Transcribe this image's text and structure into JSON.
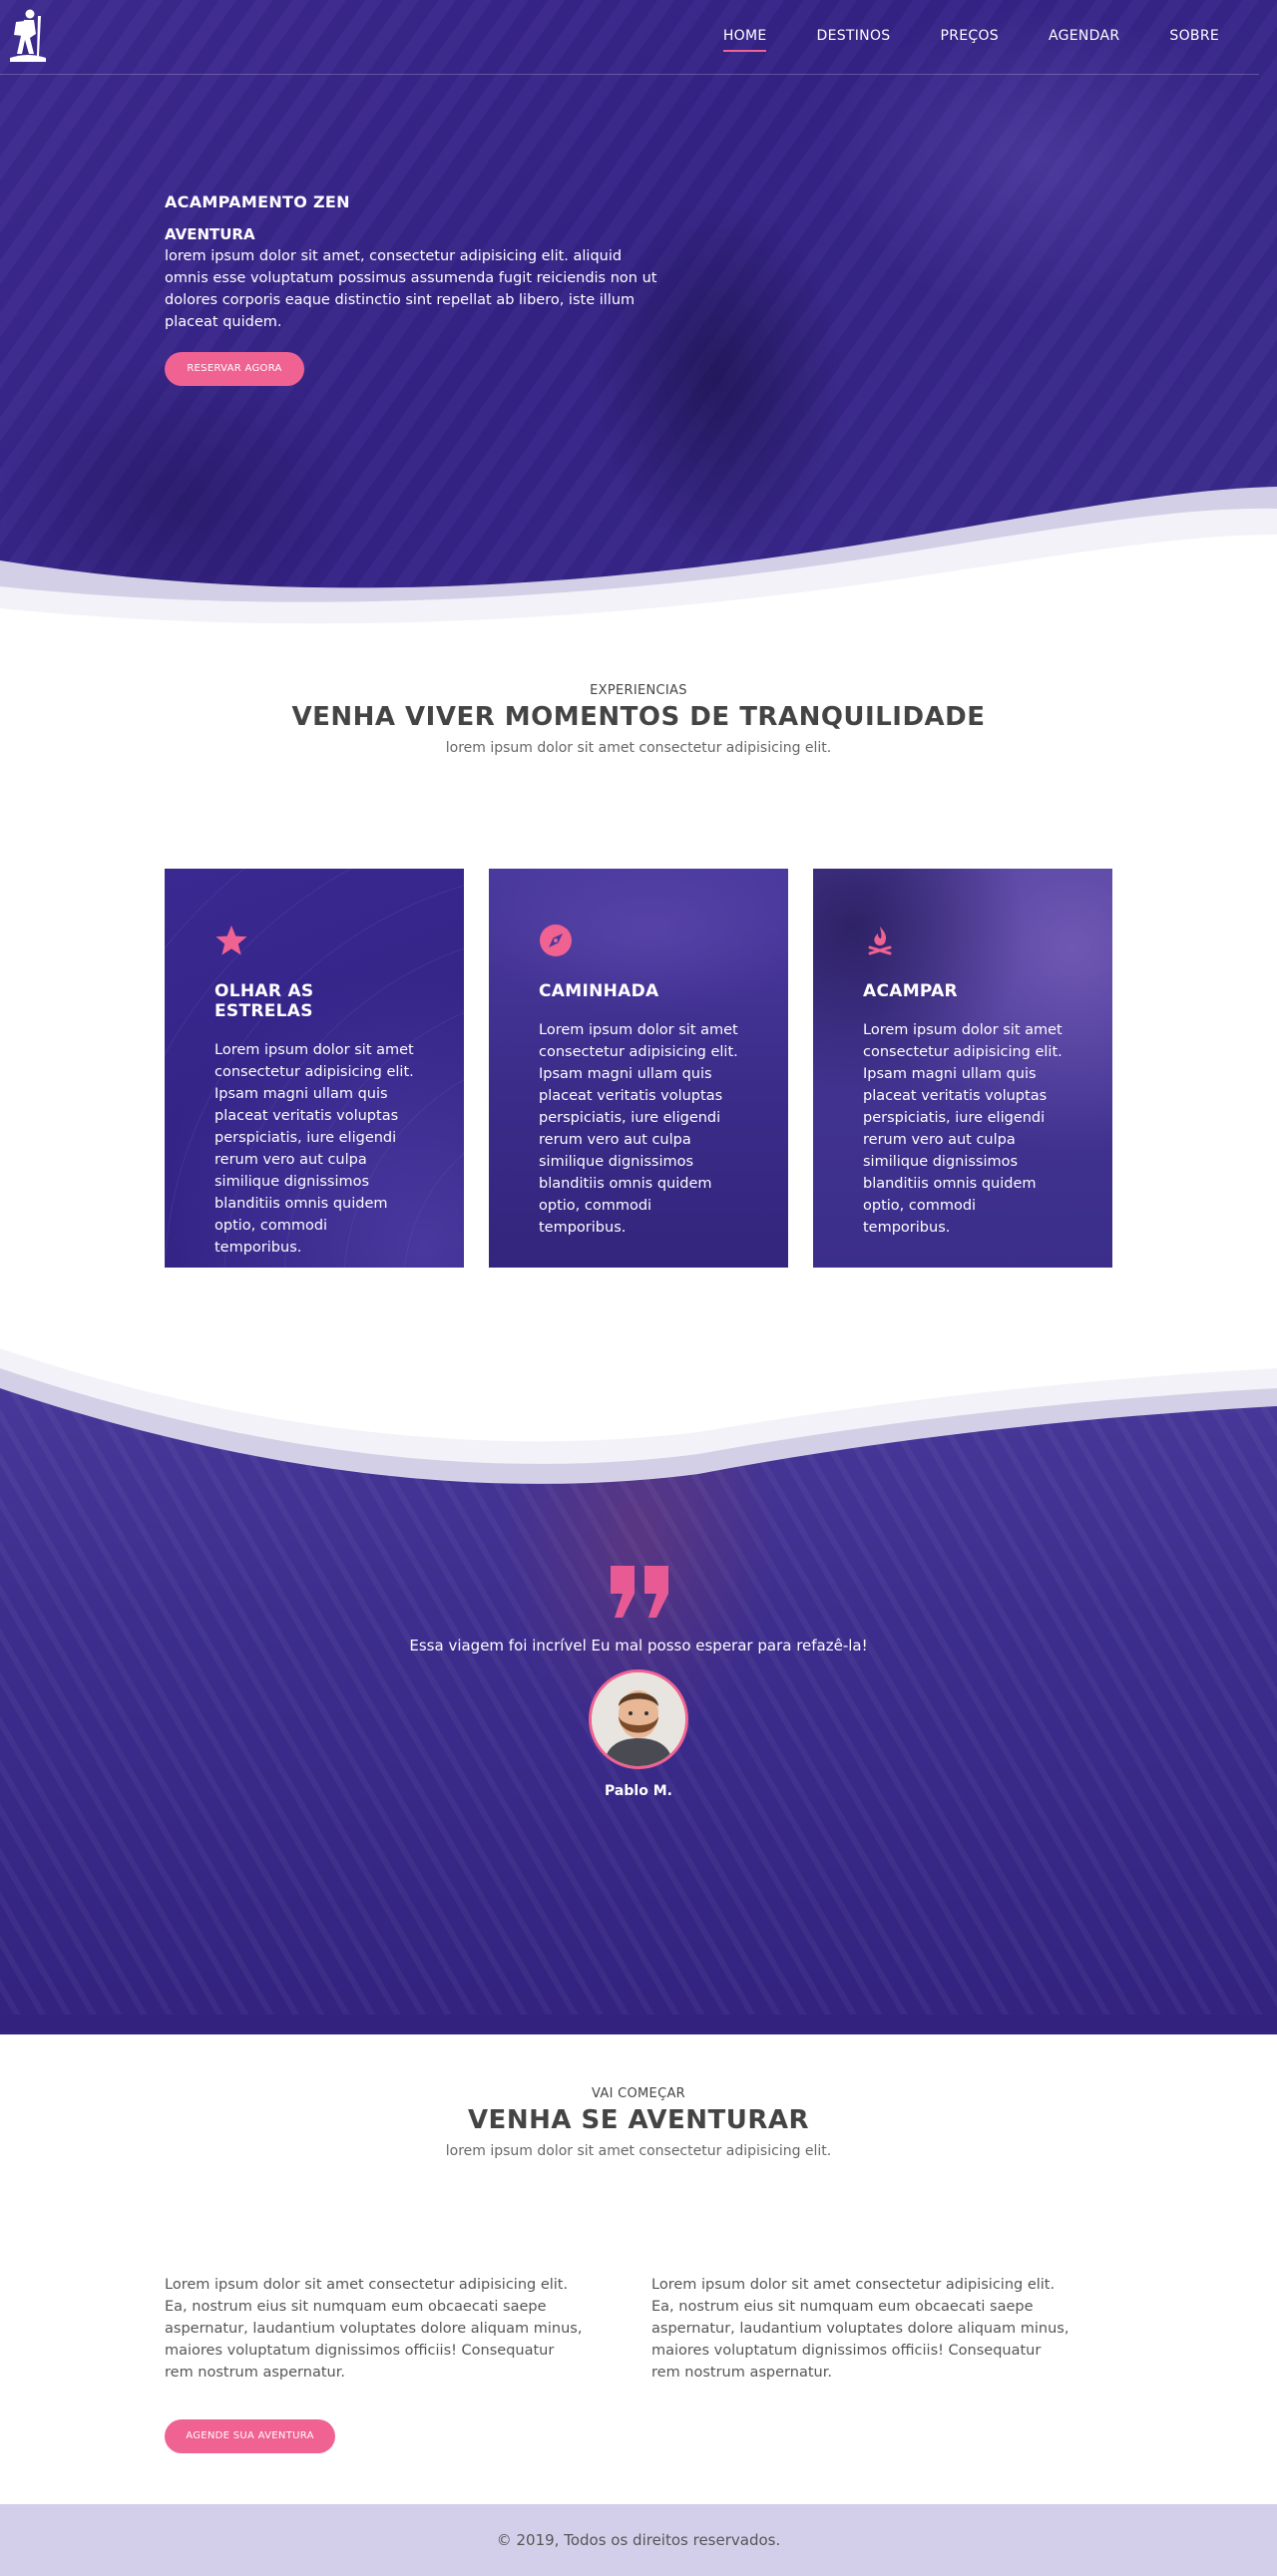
{
  "nav": {
    "logo_icon": "hiker-icon",
    "items": [
      {
        "label": "HOME",
        "active": true
      },
      {
        "label": "DESTINOS",
        "active": false
      },
      {
        "label": "PREÇOS",
        "active": false
      },
      {
        "label": "AGENDAR",
        "active": false
      },
      {
        "label": "SOBRE",
        "active": false
      }
    ]
  },
  "hero": {
    "title": "ACAMPAMENTO ZEN",
    "subtitle": "AVENTURA",
    "text": "lorem ipsum dolor sit amet, consectetur adipisicing elit. aliquid omnis esse voluptatum possimus assumenda fugit reiciendis non ut dolores corporis eaque distinctio sint repellat ab libero, iste illum placeat quidem.",
    "cta": "RESERVAR AGORA"
  },
  "experiences": {
    "kicker": "EXPERIENCIAS",
    "title": "VENHA VIVER MOMENTOS DE TRANQUILIDADE",
    "lead": "lorem ipsum dolor sit amet consectetur adipisicing elit.",
    "cards": [
      {
        "icon": "star-icon",
        "title": "OLHAR AS ESTRELAS",
        "text": "Lorem ipsum dolor sit amet consectetur adipisicing elit. Ipsam magni ullam quis placeat veritatis voluptas perspiciatis, iure eligendi rerum vero aut culpa similique dignissimos blanditiis omnis quidem optio, commodi temporibus."
      },
      {
        "icon": "compass-icon",
        "title": "CAMINHADA",
        "text": "Lorem ipsum dolor sit amet consectetur adipisicing elit. Ipsam magni ullam quis placeat veritatis voluptas perspiciatis, iure eligendi rerum vero aut culpa similique dignissimos blanditiis omnis quidem optio, commodi temporibus."
      },
      {
        "icon": "campfire-icon",
        "title": "ACAMPAR",
        "text": "Lorem ipsum dolor sit amet consectetur adipisicing elit. Ipsam magni ullam quis placeat veritatis voluptas perspiciatis, iure eligendi rerum vero aut culpa similique dignissimos blanditiis omnis quidem optio, commodi temporibus."
      }
    ]
  },
  "testimonial": {
    "quote": "Essa viagem foi incrível Eu mal posso esperar para refazê-la!",
    "author": "Pablo M."
  },
  "adventure": {
    "kicker": "VAI COMEÇAR",
    "title": "VENHA SE AVENTURAR",
    "lead": "lorem ipsum dolor sit amet consectetur adipisicing elit.",
    "col1": "Lorem ipsum dolor sit amet consectetur adipisicing elit. Ea, nostrum eius sit numquam eum obcaecati saepe aspernatur, laudantium voluptates dolore aliquam minus, maiores voluptatum dignissimos officiis! Consequatur rem nostrum aspernatur.",
    "col2": "Lorem ipsum dolor sit amet consectetur adipisicing elit. Ea, nostrum eius sit numquam eum obcaecati saepe aspernatur, laudantium voluptates dolore aliquam minus, maiores voluptatum dignissimos officiis! Consequatur rem nostrum aspernatur.",
    "cta": "AGENDE SUA AVENTURA"
  },
  "footer": {
    "copyright": "© 2019, Todos os direitos reservados."
  },
  "colors": {
    "brand_purple": "#3a2a8c",
    "accent_pink": "#f06292",
    "footer_bg": "#d3cfea"
  }
}
